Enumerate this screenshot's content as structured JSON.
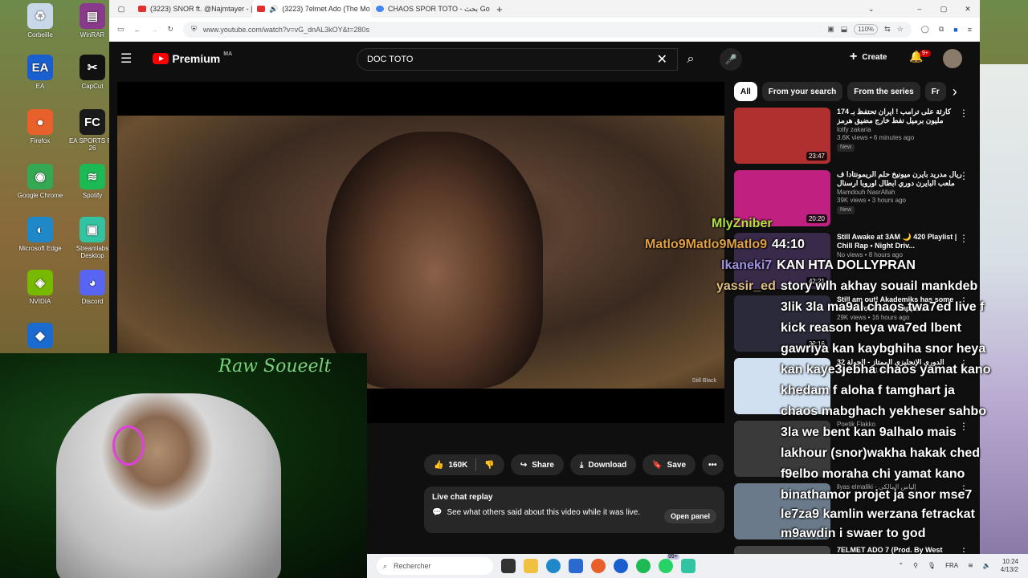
{
  "desktop": {
    "icons": [
      {
        "label": "Corbeille",
        "icon": "recycle-bin-icon",
        "glyph": "♻",
        "bg": "#c8d8e8"
      },
      {
        "label": "WinRAR",
        "icon": "winrar-icon",
        "glyph": "▤",
        "bg": "#8a3a8a"
      },
      {
        "label": "EA",
        "icon": "ea-icon",
        "glyph": "EA",
        "bg": "#1a5fd0"
      },
      {
        "label": "CapCut",
        "icon": "capcut-icon",
        "glyph": "✂",
        "bg": "#111111"
      },
      {
        "label": "Firefox",
        "icon": "firefox-icon",
        "glyph": "●",
        "bg": "#e8602a"
      },
      {
        "label": "EA SPORTS FC 26",
        "icon": "ea-sports-fc-icon",
        "glyph": "FC",
        "bg": "#1a1a1a"
      },
      {
        "label": "Google Chrome",
        "icon": "chrome-icon",
        "glyph": "◉",
        "bg": "#34a853"
      },
      {
        "label": "Spotify",
        "icon": "spotify-icon",
        "glyph": "≋",
        "bg": "#1db954"
      },
      {
        "label": "Microsoft Edge",
        "icon": "edge-icon",
        "glyph": "◐",
        "bg": "#1e88c8"
      },
      {
        "label": "Streamlabs Desktop",
        "icon": "streamlabs-icon",
        "glyph": "▣",
        "bg": "#31c3a2"
      },
      {
        "label": "NVIDIA",
        "icon": "nvidia-icon",
        "glyph": "◈",
        "bg": "#76b900"
      },
      {
        "label": "Discord",
        "icon": "discord-icon",
        "glyph": "◕",
        "bg": "#5865f2"
      },
      {
        "label": "",
        "icon": "game-controller-icon",
        "glyph": "◆",
        "bg": "#1a6ad0"
      }
    ]
  },
  "browser": {
    "tabs": [
      {
        "label": "(3223) SNOR ft. @Najmtayer - |",
        "active": false
      },
      {
        "label": "(3223) 7elmet Ado (The Mo",
        "active": true
      },
      {
        "label": "CHAOS SPOR TOTO - بحث Goog",
        "active": false
      }
    ],
    "url": "www.youtube.com/watch?v=vG_dnAL3kOY&t=280s",
    "zoom": "110%"
  },
  "youtube": {
    "brand": "Premium",
    "region": "MA",
    "search_value": "DOC TOTO",
    "create_label": "Create",
    "notif_count": "9+",
    "actions": {
      "like_count": "160K",
      "share": "Share",
      "download": "Download",
      "save": "Save"
    },
    "live_chat": {
      "title": "Live chat replay",
      "desc": "See what others said about this video while it was live.",
      "open": "Open panel"
    },
    "chips": [
      "All",
      "From your search",
      "From the series",
      "Fr"
    ],
    "watermark": "Still Black",
    "recommendations": [
      {
        "title": "كارثة على ترامب ! ايران تحتفظ بـ 174 مليون برميل نفط خارج مضيق هرمز",
        "channel": "lotfy zakaria",
        "stats": "3.6K views • 6 minutes ago",
        "badge": "New",
        "duration": "23:47",
        "thumb": "#b03030"
      },
      {
        "title": "ريال مدريد بايرن ميونيخ حلم الريمونتادا ف ملعب البايرن دوري ابطال اوروبا ارسنال",
        "channel": "Mamdouh NasrAllah",
        "stats": "39K views • 3 hours ago",
        "badge": "New",
        "duration": "20:20",
        "thumb": "#c02080"
      },
      {
        "title": "Still Awake at 3AM 🌙 420 Playlist | Chill Rap • Night Driv...",
        "channel": "No views • 8 hours ago",
        "stats": "",
        "badge": "",
        "duration": "42:21",
        "thumb": "#3a2a4a"
      },
      {
        "title": "Still am out! Akademiks has some advice for the top rapper...",
        "channel": "",
        "stats": "29K views • 16 hours ago",
        "badge": "",
        "duration": "32:16",
        "thumb": "#2a2a3a"
      },
      {
        "title": "الدوري الإنجليزي الممتاز - الجولة 32",
        "channel": "",
        "stats": "1.5M views • 1 day ago",
        "badge": "",
        "duration": "",
        "thumb": "#d0e0f0"
      },
      {
        "title": "",
        "channel": "Poetik Flakko",
        "stats": "",
        "badge": "",
        "duration": "",
        "thumb": "#3a3a3a"
      },
      {
        "title": "",
        "channel": "ilyas elmaliki - إلياس المالكي",
        "stats": "",
        "badge": "",
        "duration": "",
        "thumb": "#6a7a8a"
      },
      {
        "title": "7ELMET ADO 7 (Prod. By West",
        "channel": "",
        "stats": "",
        "badge": "",
        "duration": "",
        "thumb": "#444"
      }
    ]
  },
  "stream": {
    "neon_sign": "Raw Soueelt"
  },
  "twitch_chat": [
    {
      "name": "MlyZniber",
      "msg": "",
      "name_color": "#b0e040"
    },
    {
      "name": "Matlo9Matlo9Matlo9",
      "msg": "44:10",
      "name_color": "#e0a040"
    },
    {
      "name": "Ikaneki7",
      "msg": "KAN HTA DOLLYPRAN",
      "name_color": "#a090e0"
    },
    {
      "name": "yassir_ed",
      "msg": "story wlh akhay souail mankdeb",
      "name_color": "#e0c080"
    },
    {
      "name": "",
      "msg": "3lik 3la ma9al chaos twa7ed live f",
      "name_color": "#fff"
    },
    {
      "name": "",
      "msg": "kick reason heya wa7ed lbent",
      "name_color": "#fff"
    },
    {
      "name": "",
      "msg": "gawriya kan kaybghiha snor heya",
      "name_color": "#fff"
    },
    {
      "name": "",
      "msg": "kan kaye3jebha chaos yamat kano",
      "name_color": "#fff"
    },
    {
      "name": "",
      "msg": "khedam f aloha f tamghart ja",
      "name_color": "#fff"
    },
    {
      "name": "",
      "msg": "chaos mabghach yekheser sahbo",
      "name_color": "#fff"
    },
    {
      "name": "",
      "msg": "3la we bent kan 9alhalo mais",
      "name_color": "#fff"
    },
    {
      "name": "",
      "msg": "lakhour (snor)wakha hakak ched",
      "name_color": "#fff"
    },
    {
      "name": "",
      "msg": "f9elbo moraha chi yamat kano",
      "name_color": "#fff"
    },
    {
      "name": "",
      "msg": "binathamor projet ja snor mse7",
      "name_color": "#fff"
    },
    {
      "name": "",
      "msg": "le7za9 kamlin werzana fetrackat",
      "name_color": "#fff"
    },
    {
      "name": "",
      "msg": "m9awdin i swaer to god",
      "name_color": "#fff"
    }
  ],
  "taskbar": {
    "search_placeholder": "Rechercher",
    "lang": "FRA",
    "time": "10:24",
    "date": "4/13/2",
    "messages_badge": "99+"
  }
}
